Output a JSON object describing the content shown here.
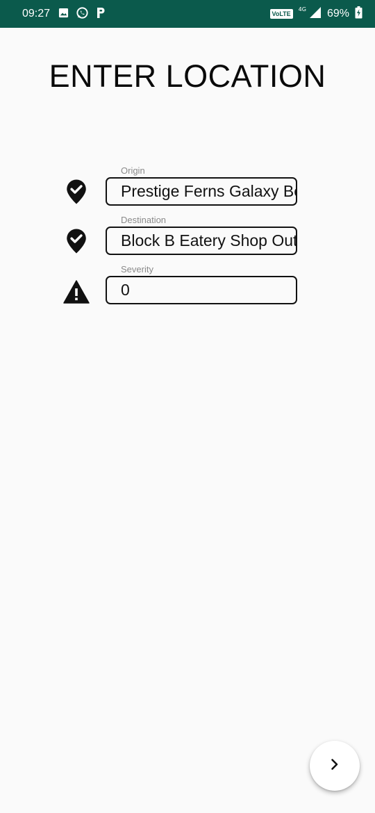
{
  "status_bar": {
    "time": "09:27",
    "left_icons": [
      "image-icon",
      "whatsapp-icon",
      "paytm-icon"
    ],
    "volte_label": "VoLTE",
    "network_label": "4G",
    "battery_percent": "69%",
    "background_color": "#0b5a4c"
  },
  "page": {
    "title": "ENTER LOCATION",
    "background_color": "#fafafa"
  },
  "fields": [
    {
      "label": "Origin",
      "value": "Prestige Ferns Galaxy Bellandur",
      "icon": "location-check-icon"
    },
    {
      "label": "Destination",
      "value": "Block B Eatery Shop Outlet",
      "icon": "location-check-icon"
    },
    {
      "label": "Severity",
      "value": "0",
      "icon": "warning-icon"
    }
  ],
  "fab": {
    "icon": "chevron-right-icon"
  }
}
